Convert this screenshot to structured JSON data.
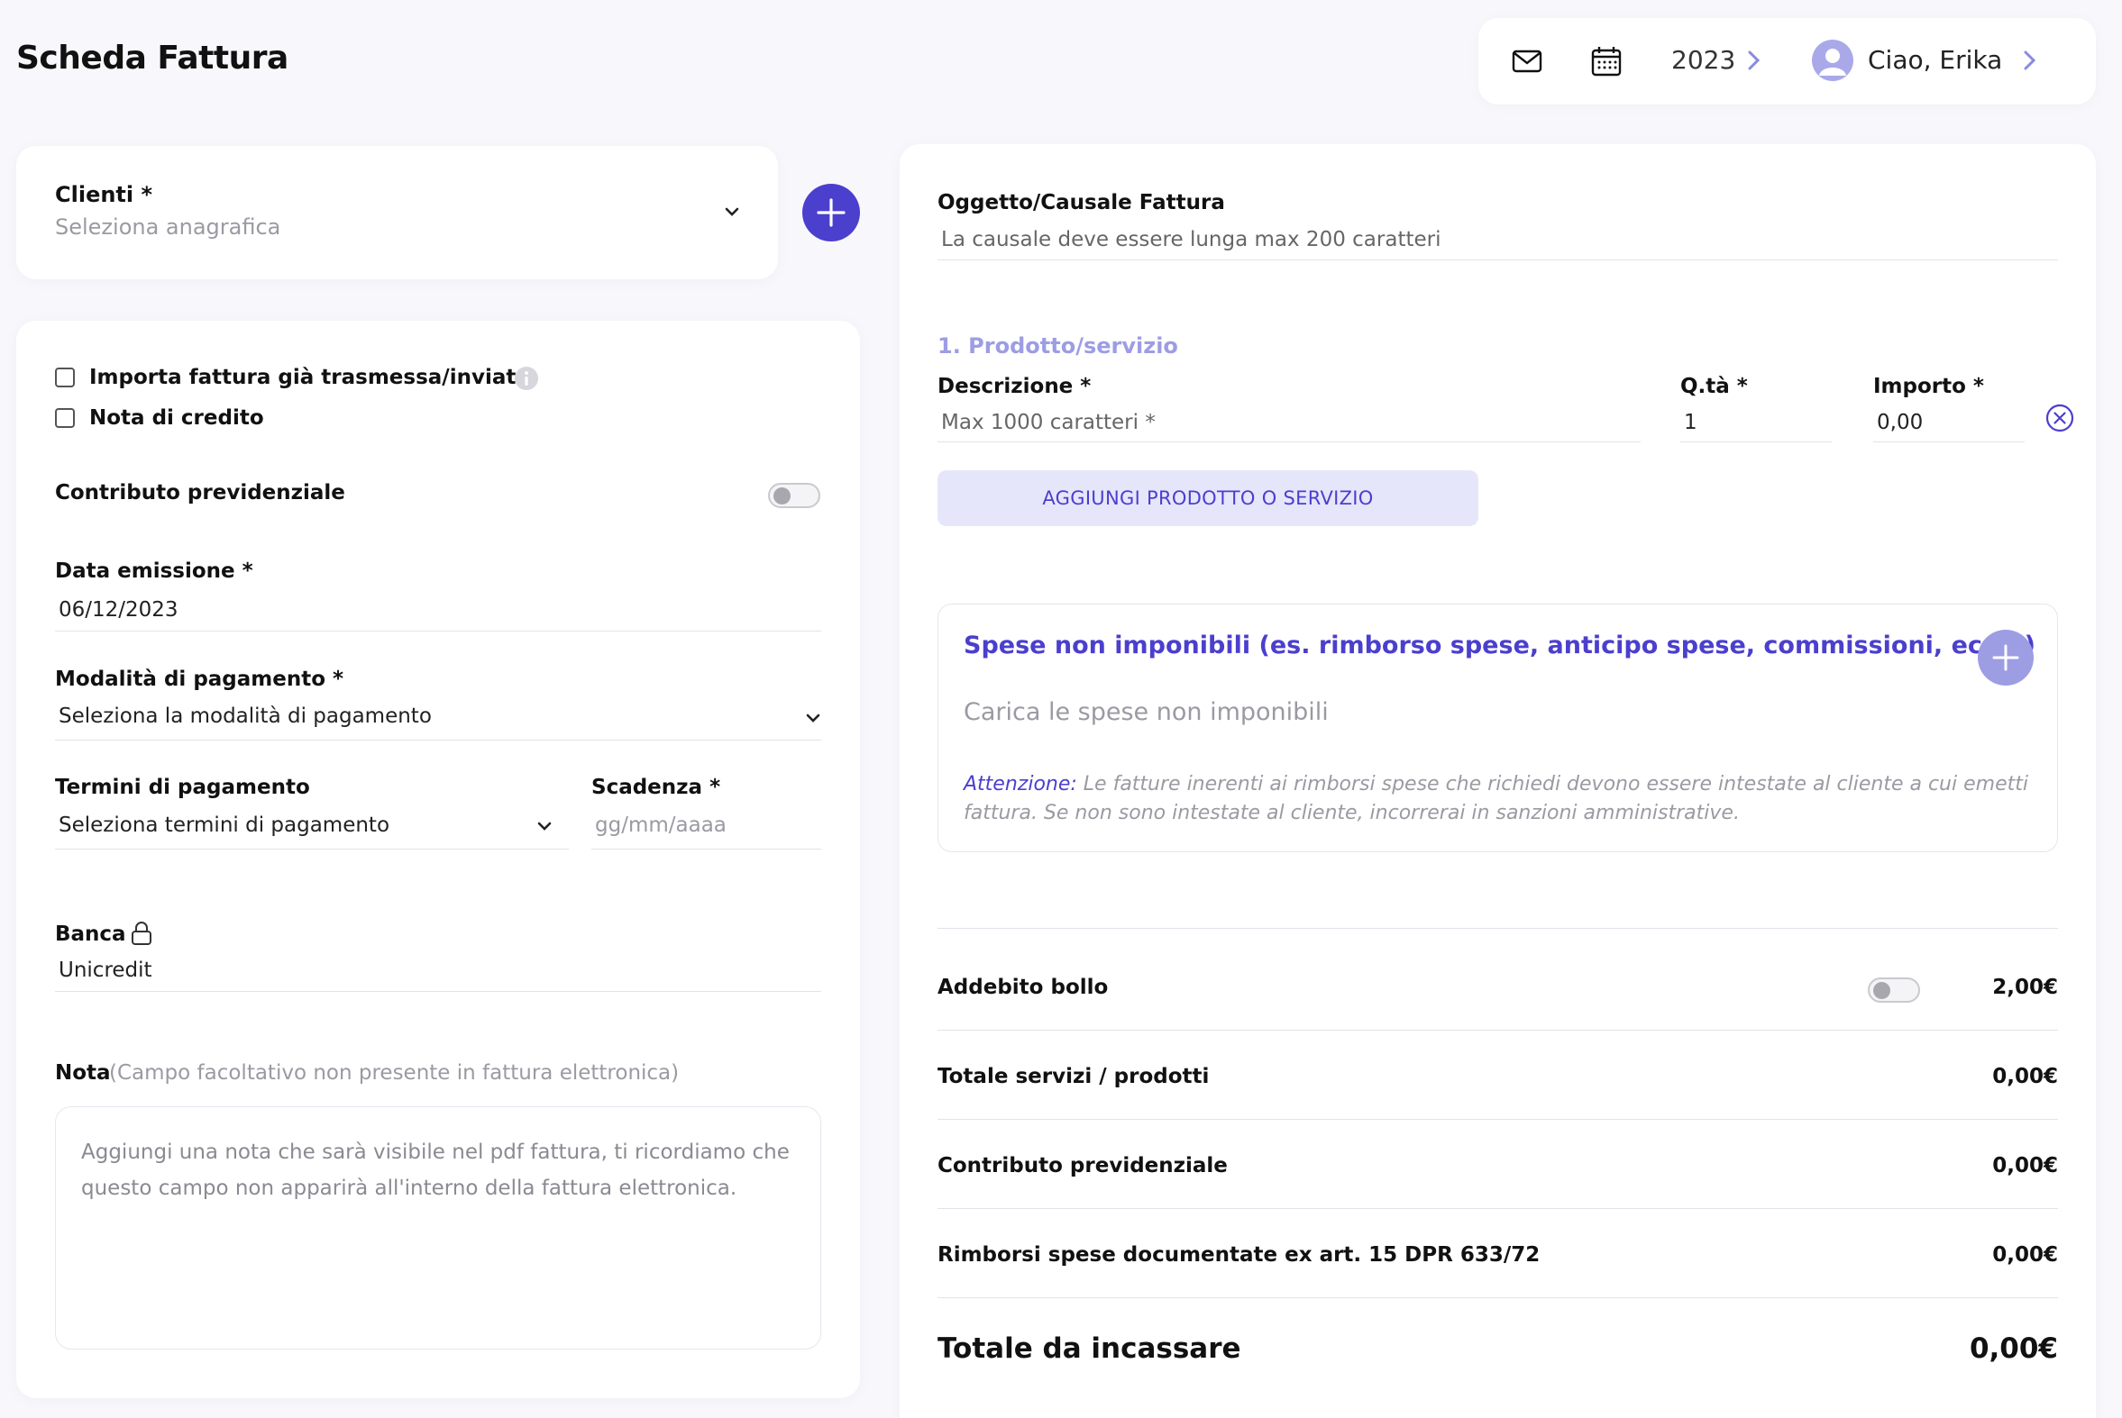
{
  "page": {
    "title": "Scheda Fattura"
  },
  "header": {
    "mail_icon": "mail-icon",
    "calendar_icon": "calendar-icon",
    "year": "2023",
    "greeting": "Ciao, Erika"
  },
  "client": {
    "label": "Clienti *",
    "placeholder": "Seleziona anagrafica"
  },
  "left_form": {
    "import_label": "Importa fattura già trasmessa/inviata",
    "credit_note_label": "Nota di credito",
    "contributo_label": "Contributo previdenziale",
    "data_emissione_label": "Data emissione *",
    "data_emissione_value": "06/12/2023",
    "modalita_label": "Modalità di pagamento *",
    "modalita_value": "Seleziona la modalità di pagamento",
    "termini_label": "Termini di pagamento",
    "termini_value": "Seleziona termini di pagamento",
    "scadenza_label": "Scadenza *",
    "scadenza_placeholder": "gg/mm/aaaa",
    "banca_label": "Banca",
    "banca_value": "Unicredit",
    "nota_label": "Nota",
    "nota_hint": "(Campo facoltativo non presente in fattura elettronica)",
    "nota_placeholder": "Aggiungi una nota che sarà visibile nel pdf fattura, ti ricordiamo che questo campo non apparirà all'interno della fattura elettronica."
  },
  "right_form": {
    "oggetto_label": "Oggetto/Causale Fattura",
    "oggetto_placeholder": "La causale deve essere lunga max 200 caratteri",
    "product_section": "1. Prodotto/servizio",
    "descrizione_label": "Descrizione *",
    "descrizione_placeholder": "Max 1000 caratteri *",
    "qta_label": "Q.tà *",
    "qta_value": "1",
    "importo_label": "Importo *",
    "importo_value": "0,00",
    "add_product_label": "AGGIUNGI PRODOTTO O SERVIZIO",
    "spese_title": "Spese non imponibili (es. rimborso spese, anticipo spese, commissioni, ecc...)",
    "spese_placeholder": "Carica le spese non imponibili",
    "spese_att": "Attenzione:",
    "spese_note": " Le fatture inerenti ai rimborsi spese che richiedi devono essere intestate al cliente a cui emetti fattura. Se non sono intestate al cliente, incorrerai in sanzioni amministrative."
  },
  "summary": {
    "bollo_label": "Addebito bollo",
    "bollo_value": "2,00€",
    "totale_servizi_label": "Totale servizi / prodotti",
    "totale_servizi_value": "0,00€",
    "contributo_label": "Contributo previdenziale",
    "contributo_value": "0,00€",
    "rimborsi_label": "Rimborsi spese documentate ex art. 15 DPR 633/72",
    "rimborsi_value": "0,00€",
    "totale_label": "Totale da incassare",
    "totale_value": "0,00€"
  },
  "colors": {
    "accent": "#4b3fce",
    "accent_light": "#9d9de4",
    "background": "#f8f8fc"
  }
}
